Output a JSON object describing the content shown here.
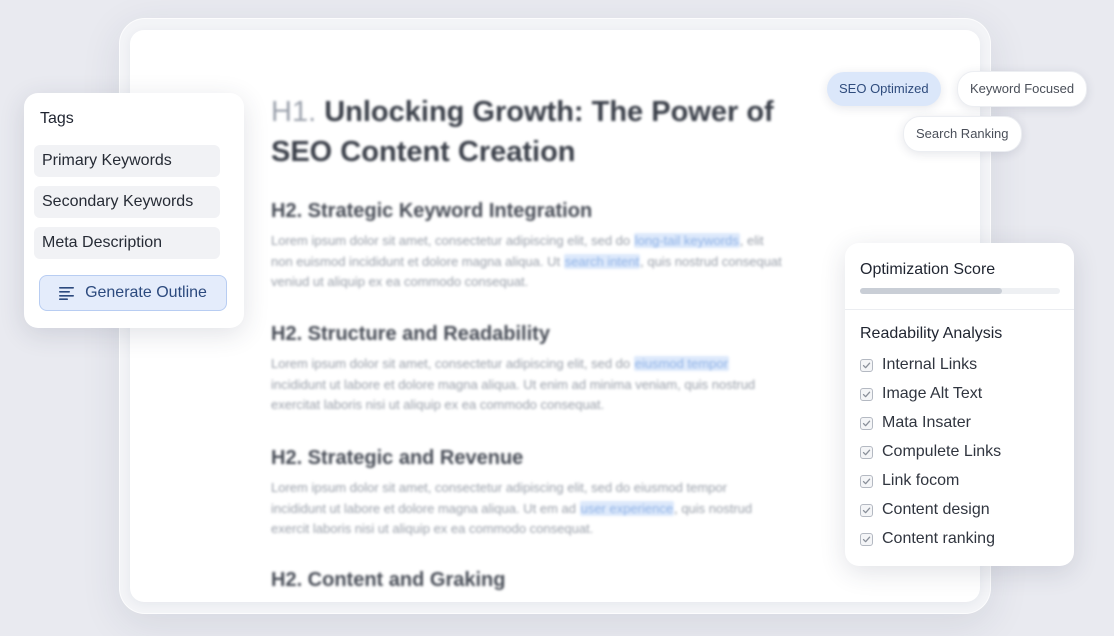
{
  "document": {
    "h1_prefix": "H1.",
    "h1_line1": "Unlocking Growth: The Power of",
    "h1_line2": "SEO Content Creation",
    "sections": [
      {
        "heading": "H2. Strategic Keyword Integration",
        "p1_before": "Lorem ipsum dolor sit amet, consectetur adipiscing elit, sed do ",
        "p1_hl": "long-tail keywords",
        "p1_after": ", elit",
        "p2_before": "non euismod incididunt et dolore magna aliqua. Ut ",
        "p2_hl": "search intent",
        "p2_after": ", quis nostrud consequat",
        "p3": "veniud ut aliquip ex ea commodo consequat."
      },
      {
        "heading": "H2. Structure and Readability",
        "p1_before": "Lorem ipsum dolor sit amet, consectetur adipiscing elit, sed do ",
        "p1_hl": "eiusmod tempor",
        "p1_after": "",
        "p2_before": "incididunt ut labore et dolore magna aliqua. Ut enim ad minima veniam, quis nostrud",
        "p2_hl": "",
        "p2_after": "",
        "p3": "exercitat laboris nisi ut aliquip ex ea commodo consequat."
      },
      {
        "heading": "H2. Strategic and Revenue",
        "p1_before": "Lorem ipsum dolor sit amet, consectetur adipiscing elit, sed do eiusmod tempor",
        "p1_hl": "",
        "p1_after": "",
        "p2_before": "incididunt ut labore et dolore magna aliqua. Ut em ad ",
        "p2_hl": "user experience",
        "p2_after": ", quis nostrud",
        "p3": "exercit laboris nisi ut aliquip ex ea commodo consequat."
      },
      {
        "heading": "H2. Content and Graking"
      }
    ]
  },
  "chips": {
    "seo_optimized": "SEO Optimized",
    "keyword_focused": "Keyword Focused",
    "search_ranking": "Search Ranking"
  },
  "tags_panel": {
    "title": "Tags",
    "items": [
      "Primary Keywords",
      "Secondary Keywords",
      "Meta Description"
    ],
    "button_label": "Generate Outline",
    "button_icon": "list-lines-icon"
  },
  "score_panel": {
    "title": "Optimization Score",
    "score_fraction": 0.71,
    "readability_title": "Readability Analysis",
    "checks": [
      "Internal Links",
      "Image Alt Text",
      "Mata Insater",
      "Compulete Links",
      "Link focom",
      "Content design",
      "Content ranking"
    ]
  },
  "colors": {
    "accent": "#dbe7fa",
    "accent_text": "#2c4a7e",
    "highlight": "#dde9fb"
  }
}
